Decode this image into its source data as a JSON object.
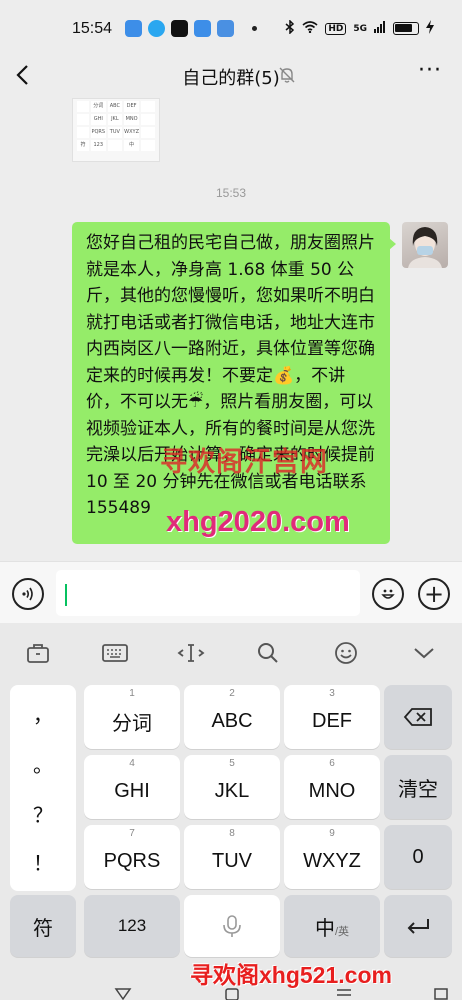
{
  "status_bar": {
    "time": "15:54",
    "signal": "5G",
    "hd": "HD"
  },
  "header": {
    "title": "自己的群(5)",
    "more": "···"
  },
  "chat": {
    "timestamp": "15:53",
    "thumbnail_keys": [
      "分词",
      "ABC",
      "DEF",
      "GHI",
      "JKL",
      "MNO",
      "PQRS",
      "TUV",
      "WXYZ",
      "符",
      "123",
      "中"
    ],
    "message": "您好自己租的民宅自己做，朋友圈照片就是本人，净身高 1.68 体重 50 公斤，其他的您慢慢听，您如果听不明白就打电话或者打微信电话，地址大连市内西岗区八一路附近，具体位置等您确定来的时候再发！不要定💰，不讲价，不可以无☔，照片看朋友圈，可以视频验证本人，所有的餐时间是从您洗完澡以后开始计算，确定来的时候提前 10 至 20 分钟先在微信或者电话联系 155489",
    "watermark_1": "寻欢阁汗宫网",
    "watermark_2": "xhg2020.com"
  },
  "input_bar": {
    "value": "",
    "plus": "+"
  },
  "keyboard": {
    "punctuation": [
      "，",
      "。",
      "？",
      "！"
    ],
    "rows": [
      [
        {
          "num": "1",
          "label": "分词"
        },
        {
          "num": "2",
          "label": "ABC"
        },
        {
          "num": "3",
          "label": "DEF"
        }
      ],
      [
        {
          "num": "4",
          "label": "GHI"
        },
        {
          "num": "5",
          "label": "JKL"
        },
        {
          "num": "6",
          "label": "MNO"
        }
      ],
      [
        {
          "num": "7",
          "label": "PQRS"
        },
        {
          "num": "8",
          "label": "TUV"
        },
        {
          "num": "9",
          "label": "WXYZ"
        }
      ]
    ],
    "clear_label": "清空",
    "zero_label": "0",
    "symbol_label": "符",
    "num_label": "123",
    "lang_label": "中",
    "lang_sub": "/英"
  },
  "watermark_bottom": "寻欢阁xhg521.com"
}
